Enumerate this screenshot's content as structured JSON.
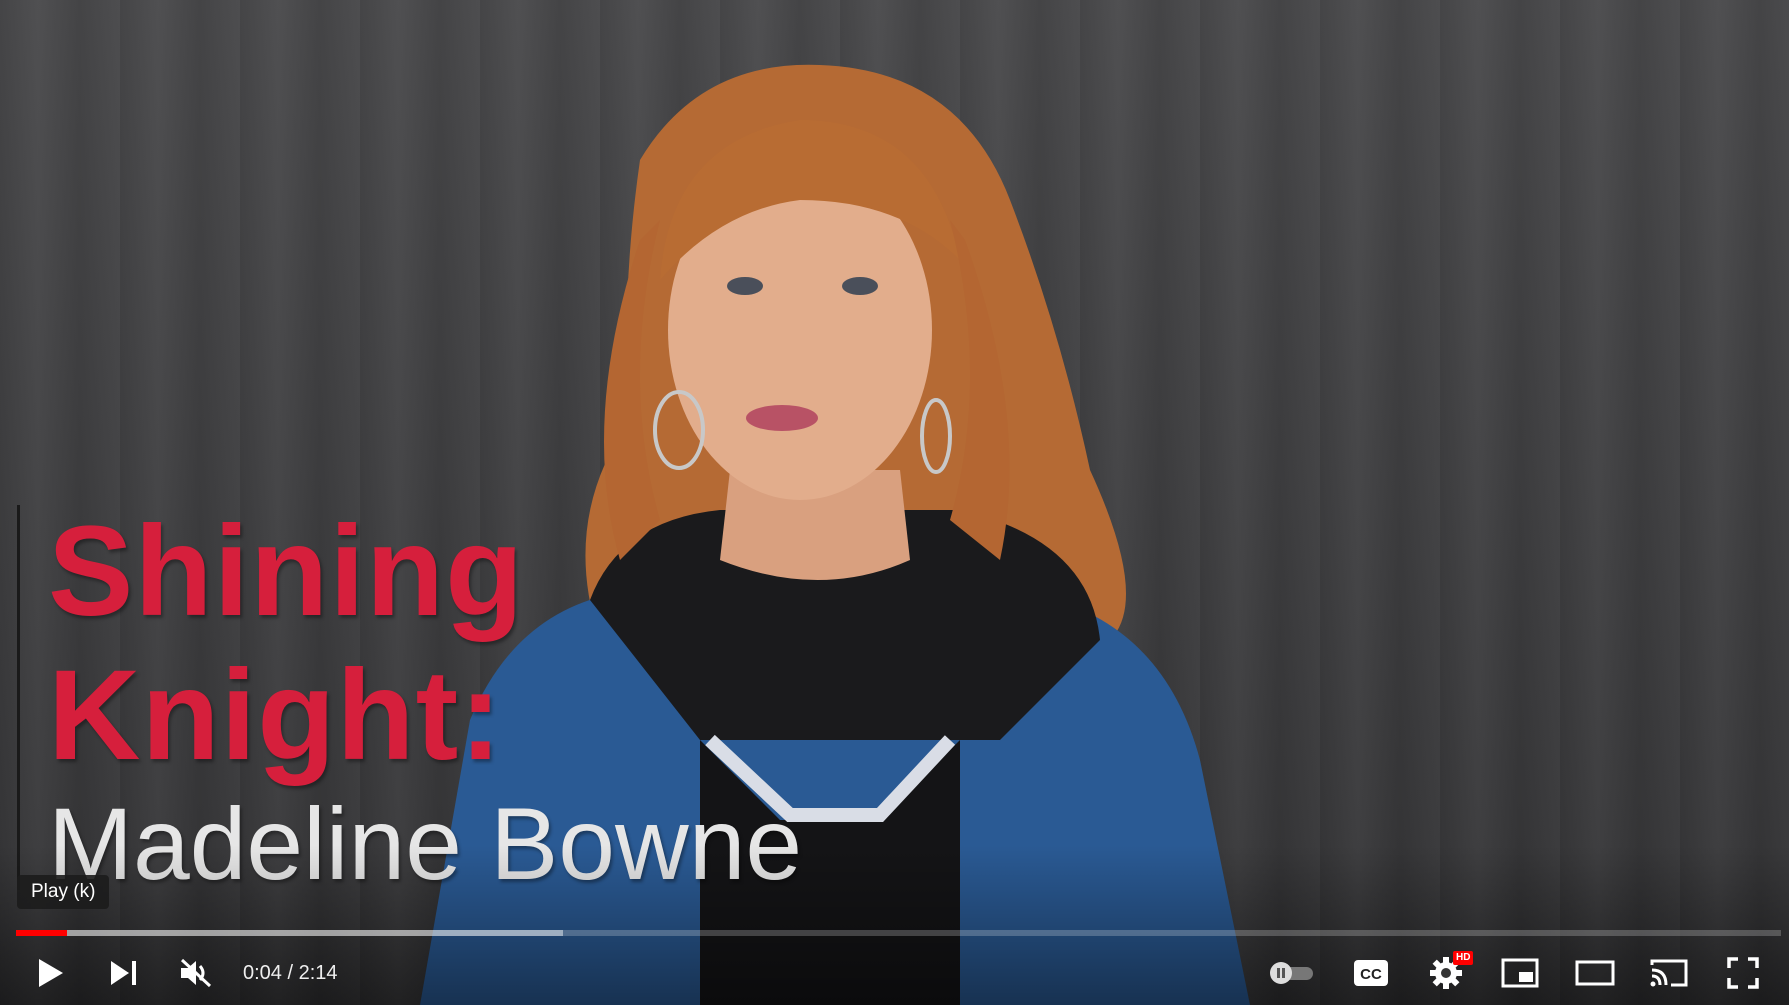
{
  "video": {
    "title_line1": "Shining",
    "title_line2": "Knight:",
    "name_line": "Madeline Bowne"
  },
  "tooltip": {
    "text": "Play (k)"
  },
  "progress": {
    "played_fraction": 0.029,
    "buffered_fraction": 0.31,
    "accent": "#ff0000"
  },
  "player": {
    "time_display": "0:04 / 2:14",
    "hd_badge": "HD",
    "icons": {
      "play": "play-icon",
      "next": "next-icon",
      "mute": "volume-muted-icon",
      "autoplay": "autoplay-toggle-icon",
      "captions": "cc-icon",
      "settings": "gear-icon",
      "miniplayer": "miniplayer-icon",
      "theater": "theater-mode-icon",
      "cast": "cast-icon",
      "fullscreen": "fullscreen-icon"
    }
  }
}
